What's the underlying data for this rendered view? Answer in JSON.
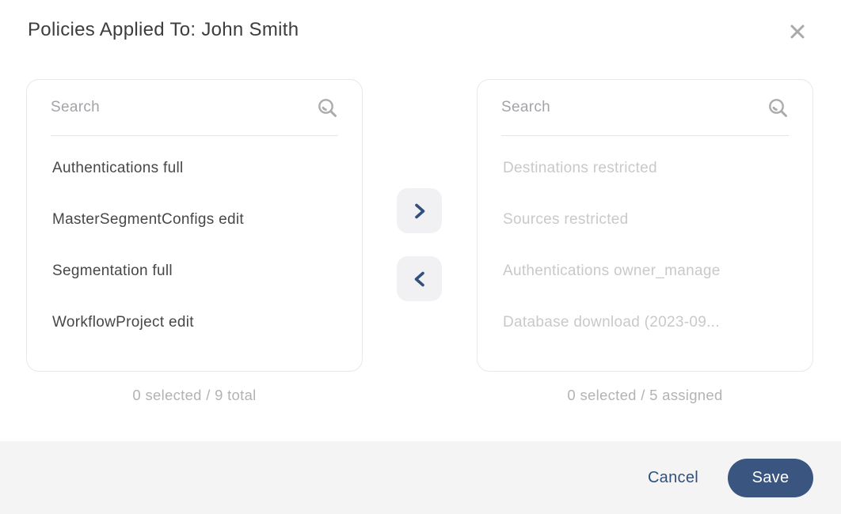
{
  "dialog": {
    "title": "Policies Applied To: John Smith"
  },
  "left_panel": {
    "search_placeholder": "Search",
    "items": [
      "Authentications full",
      "MasterSegmentConfigs edit",
      "Segmentation full",
      "WorkflowProject edit"
    ],
    "counter": "0 selected / 9 total"
  },
  "right_panel": {
    "search_placeholder": "Search",
    "items": [
      "Destinations restricted",
      "Sources restricted",
      "Authentications owner_manage",
      "Database download (2023-09..."
    ],
    "counter": "0 selected / 5 assigned"
  },
  "footer": {
    "cancel_label": "Cancel",
    "save_label": "Save"
  },
  "colors": {
    "accent_navy": "#3A5680",
    "chevron_navy": "#32507C",
    "footer_bg": "#F4F4F5",
    "panel_border": "#E8E8E8",
    "title_text": "#3D3D3D",
    "item_text": "#474747",
    "disabled_item_text": "#C9C9CB",
    "counter_text": "#B3B3B5",
    "icon_gray": "#ABABAD"
  }
}
